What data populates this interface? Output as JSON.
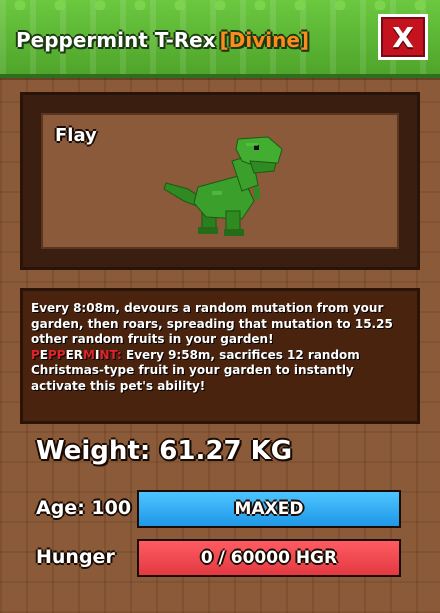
{
  "header": {
    "pet_species": "Peppermint T-Rex",
    "rarity": "[Divine]",
    "close_label": "X",
    "rarity_color": "#ff8a1e",
    "header_color": "#5bb735"
  },
  "preview": {
    "pet_name": "Flay",
    "pet_image_icon": "green-trex-pet-icon"
  },
  "description": {
    "ability_text": "Every 8:08m, devours a random mutation from your garden, then roars, spreading that mutation to 15.25 other random fruits in your garden!",
    "mutation_label_part1": "P",
    "mutation_label_part2": "E",
    "mutation_label_part3": "PP",
    "mutation_label_part4": "ER",
    "mutation_label_part5": "M",
    "mutation_label_part6": "I",
    "mutation_label_part7": "NT:",
    "mutation_text": " Every 9:58m, sacrifices 12 random Christmas-type fruit in your garden to instantly activate this pet's ability!"
  },
  "stats": {
    "weight": "Weight: 61.27 KG",
    "age_label": "Age: 100",
    "age_bar_text": "MAXED",
    "age_progress": 1.0,
    "age_color": "#1f98e6",
    "hunger_label": "Hunger",
    "hunger_bar_text": "0 / 60000 HGR",
    "hunger_progress": 1.0,
    "hunger_color": "#e33a42"
  }
}
